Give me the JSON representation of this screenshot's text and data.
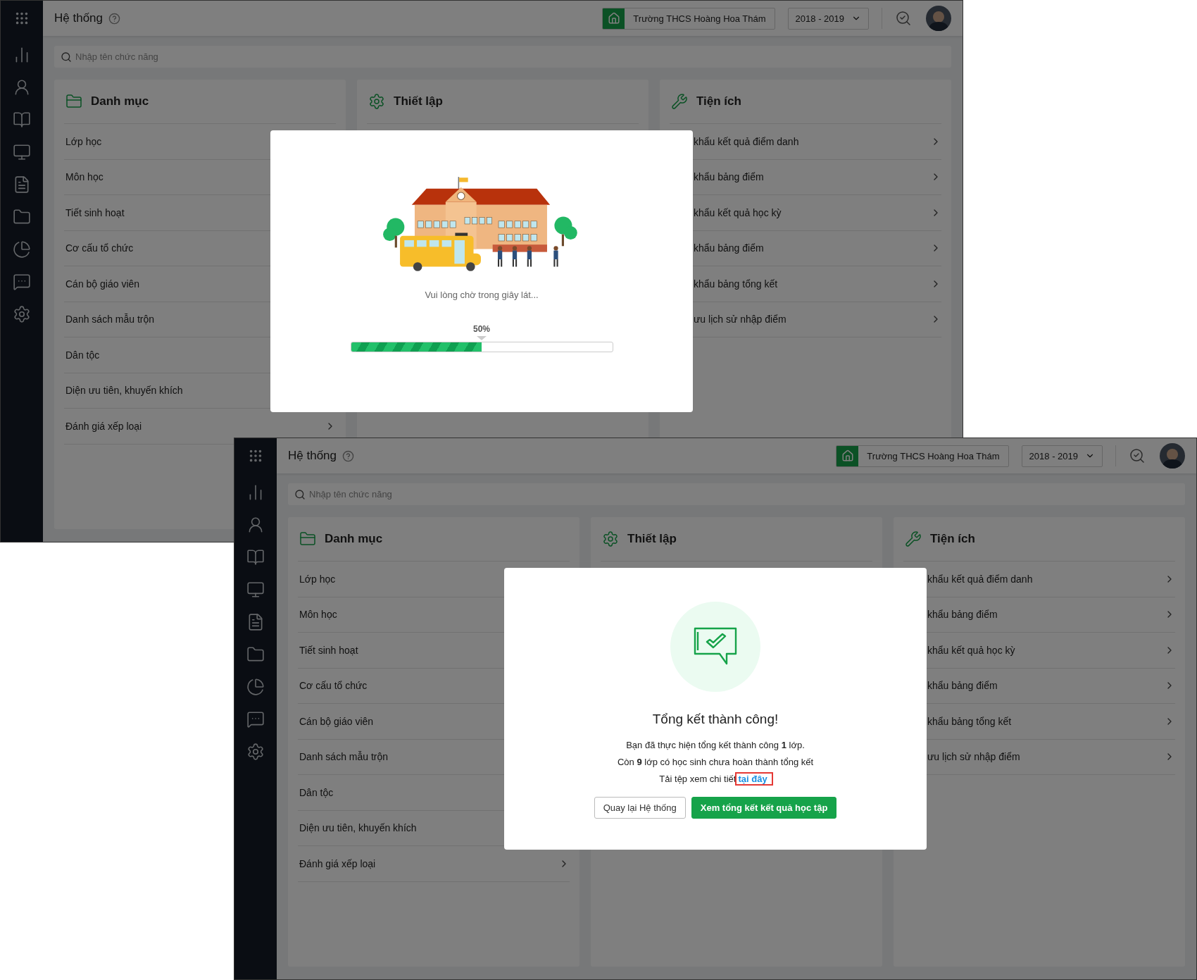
{
  "screens": [
    {
      "header": {
        "title": "Hệ thống",
        "school": "Trường THCS Hoàng Hoa Thám",
        "year": "2018 - 2019"
      },
      "search": {
        "placeholder": "Nhập tên chức năng"
      },
      "panels": [
        {
          "kind": "catalog",
          "title": "Danh mục",
          "items": [
            "Lớp học",
            "Môn học",
            "Tiết sinh hoạt",
            "Cơ cấu tổ chức",
            "Cán bộ giáo viên",
            "Danh sách mẫu trộn",
            "Dân tộc",
            "Diện ưu tiên, khuyến khích",
            "Đánh giá xếp loại"
          ]
        },
        {
          "kind": "setup",
          "title": "Thiết lập"
        },
        {
          "kind": "tools",
          "title": "Tiện ích",
          "items": [
            "khẩu kết quả điểm danh",
            "khẩu bảng điểm",
            "khẩu kết quả học kỳ",
            "khẩu bảng điểm",
            "khẩu bảng tổng kết",
            "ưu lịch sử nhập điểm"
          ]
        }
      ],
      "modal": {
        "kind": "progress",
        "message": "Vui lòng chờ trong giây lát...",
        "reading": "50%",
        "level": 0.5
      }
    },
    {
      "header": {
        "title": "Hệ thống",
        "school": "Trường THCS Hoàng Hoa Thám",
        "year": "2018 - 2019"
      },
      "search": {
        "placeholder": "Nhập tên chức năng"
      },
      "panels": [
        {
          "kind": "catalog",
          "title": "Danh mục",
          "items": [
            "Lớp học",
            "Môn học",
            "Tiết sinh hoạt",
            "Cơ cấu tổ chức",
            "Cán bộ giáo viên",
            "Danh sách mẫu trộn",
            "Dân tộc",
            "Diện ưu tiên, khuyến khích",
            "Đánh giá xếp loại"
          ]
        },
        {
          "kind": "setup",
          "title": "Thiết lập"
        },
        {
          "kind": "tools",
          "title": "Tiện ích",
          "items": [
            "khẩu kết quả điểm danh",
            "khẩu bảng điểm",
            "khẩu kết quả học kỳ",
            "khẩu bảng điểm",
            "khẩu bảng tổng kết",
            "ưu lịch sử nhập điểm"
          ]
        }
      ],
      "modal": {
        "kind": "success",
        "title": "Tổng kết thành công!",
        "lines": [
          "Bạn đã thực hiện tổng kết thành công **1** lớp.",
          "Còn **9** lớp có học sinh chưa hoàn thành tổng kết"
        ],
        "download": {
          "text": "Tải tệp xem chi tiết",
          "link": "tại đây"
        },
        "buttons": [
          {
            "label": "Quay lại Hệ thống",
            "kind": "secondary"
          },
          {
            "label": "Xem tổng kết kết quả học tập",
            "kind": "primary"
          }
        ]
      }
    }
  ]
}
